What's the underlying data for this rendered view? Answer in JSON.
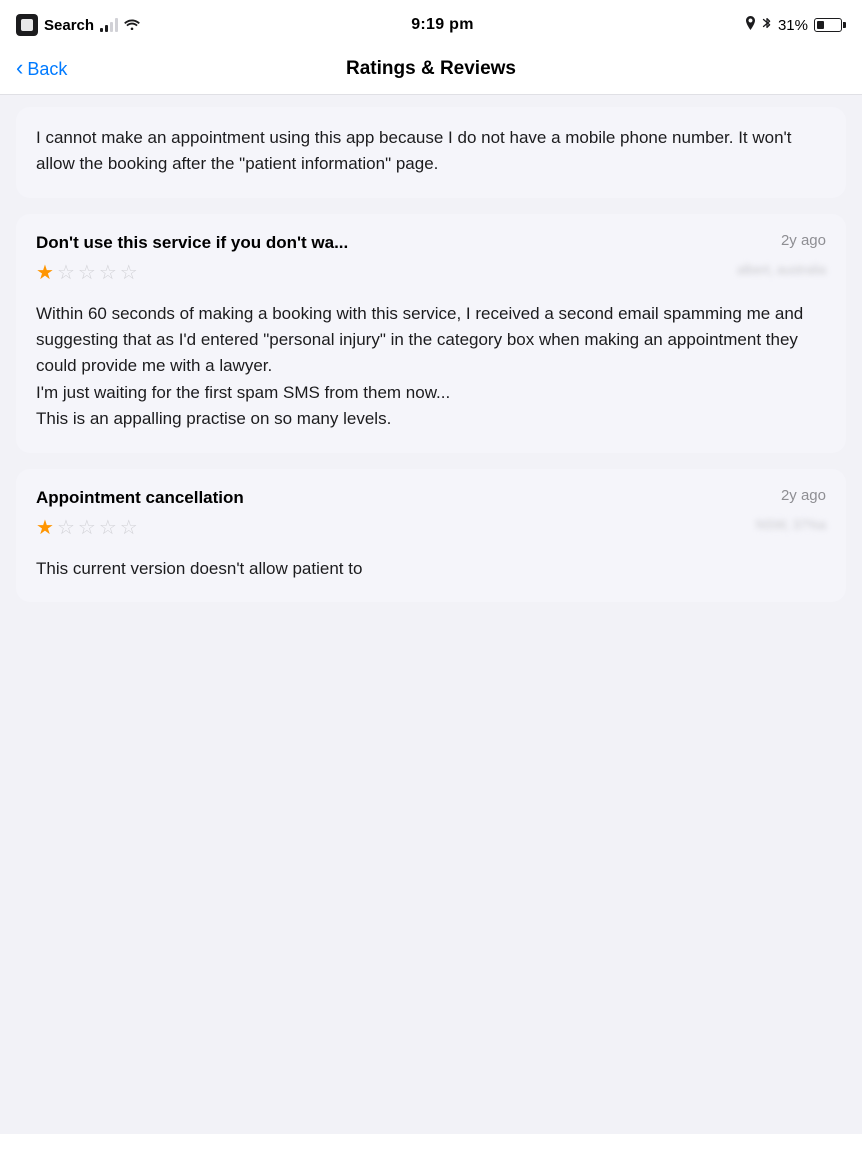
{
  "statusBar": {
    "appName": "Search",
    "time": "9:19 pm",
    "battery": "31%",
    "batteryFillPercent": 31
  },
  "navBar": {
    "backLabel": "Back",
    "title": "Ratings & Reviews"
  },
  "reviews": [
    {
      "id": "partial-top",
      "partial": true,
      "body": "I cannot make an appointment using this app because I do not have a mobile phone number. It won't allow the booking after the \"patient information\" page."
    },
    {
      "id": "review-2",
      "title": "Don't use this service if you don't wa...",
      "time": "2y ago",
      "stars": 1,
      "totalStars": 5,
      "location": "albert, australia",
      "body": "Within 60 seconds of making a booking with this service, I received a second email spamming me and suggesting that as I'd entered \"personal injury\" in the category box when making an appointment they could provide me with a lawyer.\nI'm just waiting for the first spam SMS from them now...\nThis is an appalling practise on so many levels."
    },
    {
      "id": "review-3",
      "title": "Appointment cancellation",
      "time": "2y ago",
      "stars": 1,
      "totalStars": 5,
      "location": "NSW, 37%a",
      "body": "This current version doesn't allow patient to"
    }
  ],
  "icons": {
    "back": "‹",
    "starFilled": "★",
    "starEmpty": "☆"
  }
}
